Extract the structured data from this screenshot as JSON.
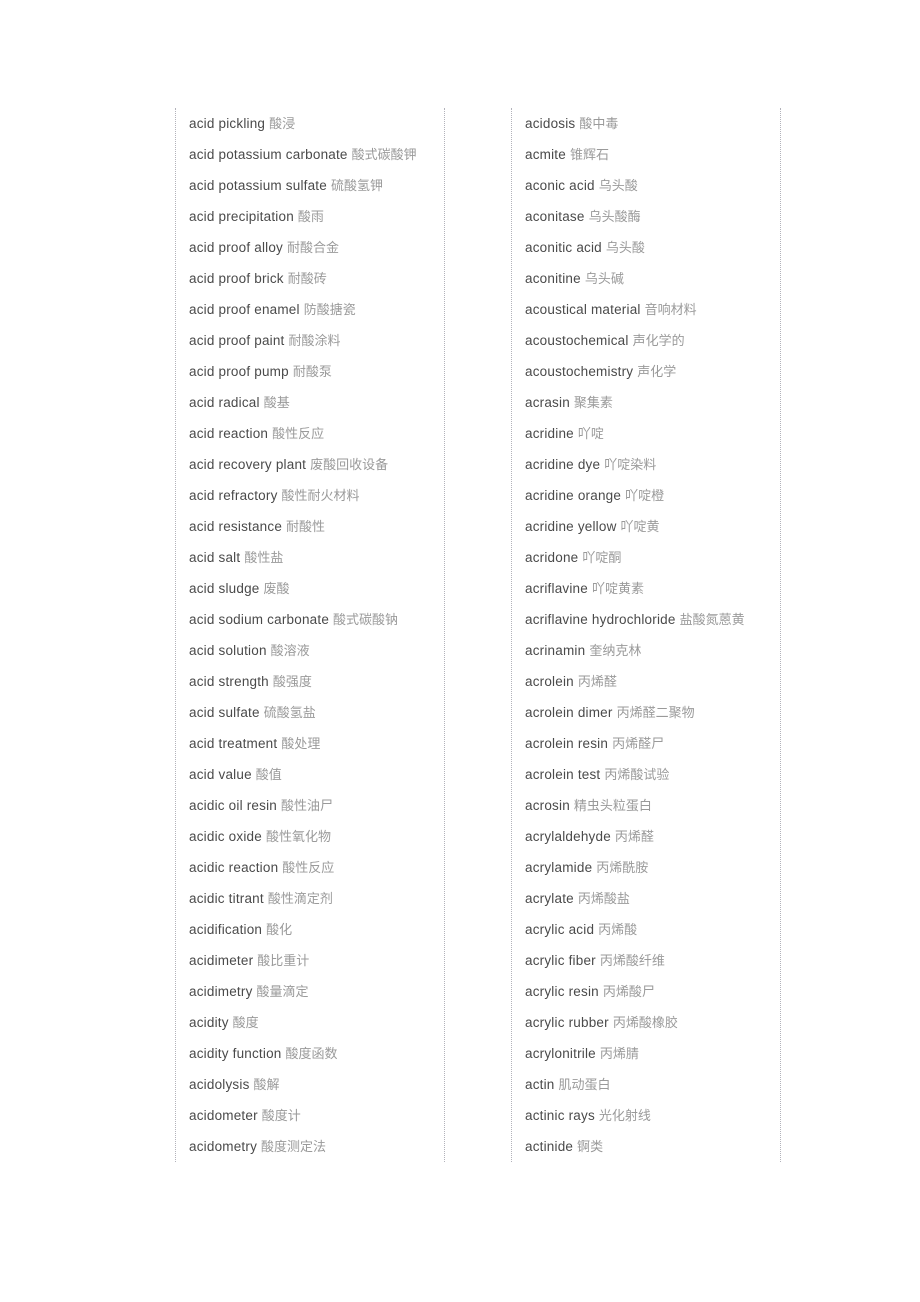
{
  "document": {
    "type": "bilingual-glossary",
    "page_background": "#ffffff",
    "term_color": "#4a4a4a",
    "gloss_color": "#9a9a9a",
    "rule_color": "#b2b2ba"
  },
  "columns": [
    {
      "name": "left-column",
      "entries": [
        {
          "term": "acid  pickling",
          "gloss": "酸浸"
        },
        {
          "term": "acid  potassium  carbonate",
          "gloss": "酸式碳酸钾"
        },
        {
          "term": "acid  potassium  sulfate",
          "gloss": "硫酸氢钾"
        },
        {
          "term": "acid  precipitation",
          "gloss": "酸雨"
        },
        {
          "term": "acid  proof  alloy",
          "gloss": "耐酸合金"
        },
        {
          "term": "acid  proof  brick",
          "gloss": "耐酸砖"
        },
        {
          "term": "acid  proof  enamel",
          "gloss": "防酸搪瓷"
        },
        {
          "term": "acid  proof  paint",
          "gloss": "耐酸涂料"
        },
        {
          "term": "acid  proof  pump",
          "gloss": "耐酸泵"
        },
        {
          "term": "acid  radical",
          "gloss": "酸基"
        },
        {
          "term": "acid  reaction",
          "gloss": "酸性反应"
        },
        {
          "term": "acid  recovery  plant",
          "gloss": "废酸回收设备"
        },
        {
          "term": "acid  refractory",
          "gloss": "酸性耐火材料"
        },
        {
          "term": "acid  resistance",
          "gloss": "耐酸性"
        },
        {
          "term": "acid  salt",
          "gloss": "酸性盐"
        },
        {
          "term": "acid  sludge",
          "gloss": "废酸"
        },
        {
          "term": "acid  sodium  carbonate",
          "gloss": "酸式碳酸钠"
        },
        {
          "term": "acid  solution",
          "gloss": "酸溶液"
        },
        {
          "term": "acid  strength",
          "gloss": "酸强度"
        },
        {
          "term": "acid  sulfate",
          "gloss": "硫酸氢盐"
        },
        {
          "term": "acid  treatment",
          "gloss": "酸处理"
        },
        {
          "term": "acid  value",
          "gloss": "酸值"
        },
        {
          "term": "acidic  oil  resin",
          "gloss": "酸性油尸"
        },
        {
          "term": "acidic  oxide",
          "gloss": "酸性氧化物"
        },
        {
          "term": "acidic  reaction",
          "gloss": "酸性反应"
        },
        {
          "term": "acidic  titrant",
          "gloss": "酸性滴定剂"
        },
        {
          "term": "acidification",
          "gloss": "酸化"
        },
        {
          "term": "acidimeter",
          "gloss": "酸比重计"
        },
        {
          "term": "acidimetry",
          "gloss": "酸量滴定"
        },
        {
          "term": "acidity",
          "gloss": "酸度"
        },
        {
          "term": "acidity  function",
          "gloss": "酸度函数"
        },
        {
          "term": "acidolysis",
          "gloss": "酸解"
        },
        {
          "term": "acidometer",
          "gloss": "酸度计"
        },
        {
          "term": "acidometry",
          "gloss": "酸度测定法"
        }
      ]
    },
    {
      "name": "right-column",
      "entries": [
        {
          "term": "acidosis",
          "gloss": "酸中毒"
        },
        {
          "term": "acmite",
          "gloss": "锥辉石"
        },
        {
          "term": "aconic  acid",
          "gloss": "乌头酸"
        },
        {
          "term": "aconitase",
          "gloss": "乌头酸酶"
        },
        {
          "term": "aconitic  acid",
          "gloss": "乌头酸"
        },
        {
          "term": "aconitine",
          "gloss": "乌头碱"
        },
        {
          "term": "acoustical  material",
          "gloss": "音响材料"
        },
        {
          "term": "acoustochemical",
          "gloss": "声化学的"
        },
        {
          "term": "acoustochemistry",
          "gloss": "声化学"
        },
        {
          "term": "acrasin",
          "gloss": "聚集素"
        },
        {
          "term": "acridine",
          "gloss": "吖啶"
        },
        {
          "term": "acridine  dye",
          "gloss": "吖啶染料"
        },
        {
          "term": "acridine  orange",
          "gloss": "吖啶橙"
        },
        {
          "term": "acridine  yellow",
          "gloss": "吖啶黄"
        },
        {
          "term": "acridone",
          "gloss": "吖啶酮"
        },
        {
          "term": "acriflavine",
          "gloss": "吖啶黄素"
        },
        {
          "term": "acriflavine  hydrochloride",
          "gloss": "盐酸氮蒽黄"
        },
        {
          "term": "acrinamin",
          "gloss": "奎纳克林"
        },
        {
          "term": "acrolein",
          "gloss": "丙烯醛"
        },
        {
          "term": "acrolein  dimer",
          "gloss": "丙烯醛二聚物"
        },
        {
          "term": "acrolein  resin",
          "gloss": "丙烯醛尸"
        },
        {
          "term": "acrolein  test",
          "gloss": "丙烯酸试验"
        },
        {
          "term": "acrosin",
          "gloss": "精虫头粒蛋白"
        },
        {
          "term": "acrylaldehyde",
          "gloss": "丙烯醛"
        },
        {
          "term": "acrylamide",
          "gloss": "丙烯酰胺"
        },
        {
          "term": "acrylate",
          "gloss": "丙烯酸盐"
        },
        {
          "term": "acrylic  acid",
          "gloss": "丙烯酸"
        },
        {
          "term": "acrylic  fiber",
          "gloss": "丙烯酸纤维"
        },
        {
          "term": "acrylic  resin",
          "gloss": "丙烯酸尸"
        },
        {
          "term": "acrylic  rubber",
          "gloss": "丙烯酸橡胶"
        },
        {
          "term": "acrylonitrile",
          "gloss": "丙烯腈"
        },
        {
          "term": "actin",
          "gloss": "肌动蛋白"
        },
        {
          "term": "actinic  rays",
          "gloss": "光化射线"
        },
        {
          "term": "actinide",
          "gloss": "锕类"
        }
      ]
    }
  ]
}
